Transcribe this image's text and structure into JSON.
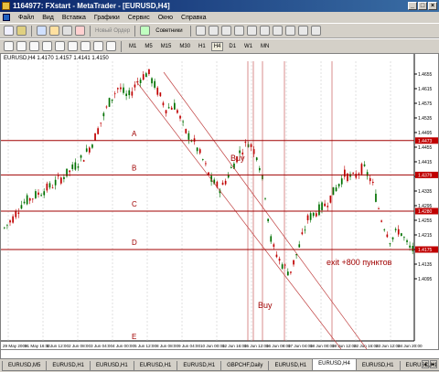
{
  "window": {
    "title": "1164977: FXstart - MetaTrader - [EURUSD,H4]",
    "controls": [
      "_",
      "□",
      "×"
    ]
  },
  "menu": {
    "items": [
      "Файл",
      "Вид",
      "Вставка",
      "Графики",
      "Сервис",
      "Окно",
      "Справка"
    ]
  },
  "toolbar2": {
    "new_order": "Новый Ордер",
    "advisors": "Советники",
    "timeframes": [
      "M1",
      "M5",
      "M15",
      "M30",
      "H1",
      "H4",
      "D1",
      "W1",
      "MN"
    ],
    "active_timeframe": "H4"
  },
  "chart": {
    "info": "EURUSD,H4  1.4170 1.4157 1.4141 1.4150",
    "price_labels": [
      "1.4655",
      "1.4615",
      "1.4575",
      "1.4535",
      "1.4495",
      "1.4455",
      "1.4415",
      "1.4375",
      "1.4335",
      "1.4295",
      "1.4255",
      "1.4215",
      "1.4175",
      "1.4135",
      "1.4095"
    ],
    "time_labels": [
      "29 May 2009",
      "31 May 16:00",
      "1 Jun 12:00",
      "2 Jun 08:00",
      "3 Jun 04:00",
      "4 Jun 00:00",
      "5 Jun 12:00",
      "8 Jun 08:00",
      "9 Jun 04:00",
      "10 Jun 00:00",
      "12 Jun 16:00",
      "15 Jun 12:00",
      "16 Jun 08:00",
      "17 Jun 04:00",
      "18 Jun 00:00",
      "19 Jun 12:00",
      "22 Jun 16:00",
      "23 Jun 12:00",
      "24 Jun 20:00"
    ],
    "level_tags": [
      "1.4473",
      "1.4379",
      "1.4280",
      "1.4175"
    ],
    "level_letters": [
      "A",
      "B",
      "C",
      "D",
      "E"
    ],
    "annotations": {
      "buy_top": "Buy",
      "buy_bottom": "Buy",
      "exit": "exit +800 пунктов"
    },
    "colors": {
      "level_line": "#a00000",
      "channel_line": "#c04040",
      "bull_candle": "#007000",
      "bear_candle": "#c00000",
      "grid": "#c0c0c0",
      "tag_bg": "#c00000"
    }
  },
  "tabs": {
    "items": [
      "EURUSD,M5",
      "EURUSD,H1",
      "EURUSD,H1",
      "EURUSD,H1",
      "EURUSD,H1",
      "GBPCHF,Daily",
      "EURUSD,H1",
      "EURUSD,H4",
      "EURUSD,H1",
      "EURUSD,H1"
    ],
    "active_index": 7
  }
}
